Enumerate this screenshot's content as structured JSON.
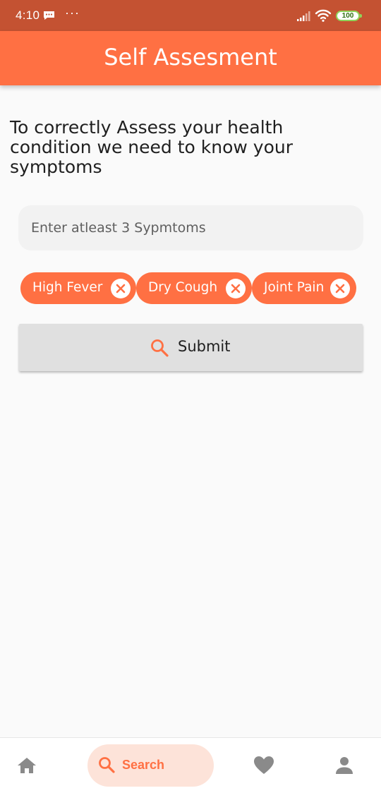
{
  "status_bar": {
    "time": "4:10",
    "dots": "···",
    "battery": "100"
  },
  "app_bar": {
    "title": "Self Assesment"
  },
  "main": {
    "instruction": "To correctly Assess your health condition we need to know your symptoms",
    "symptom_input": {
      "placeholder": "Enter atleast 3 Sypmtoms",
      "value": ""
    },
    "chips": [
      {
        "label": "High Fever"
      },
      {
        "label": "Dry Cough"
      },
      {
        "label": "Joint Pain"
      }
    ],
    "submit_label": "Submit"
  },
  "bottom_nav": {
    "items": [
      {
        "icon": "home-icon",
        "label": ""
      },
      {
        "icon": "search-icon",
        "label": "Search",
        "active": true
      },
      {
        "icon": "heart-icon",
        "label": ""
      },
      {
        "icon": "person-icon",
        "label": ""
      }
    ]
  },
  "colors": {
    "status_bar": "#c45232",
    "accent": "#ff7043",
    "active_nav_bg": "#fde3d9",
    "icon_gray": "#8a8a8a"
  }
}
